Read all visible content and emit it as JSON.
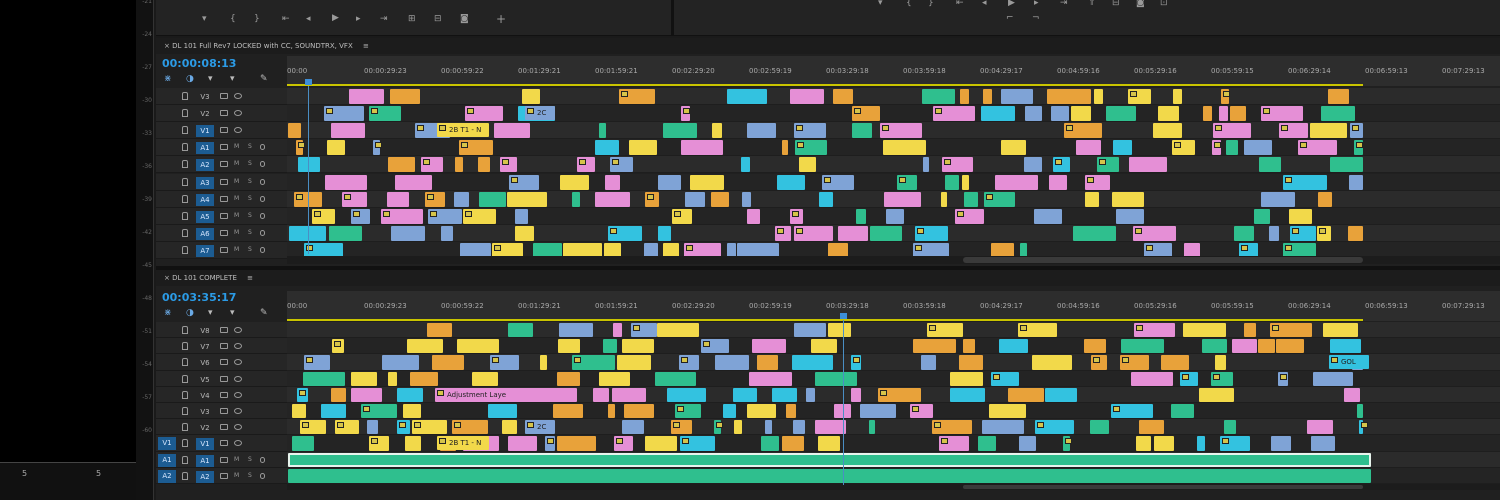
{
  "left_bottom": {
    "value_1": "5",
    "value_2": "5"
  },
  "meter_ticks": [
    "-21",
    "-24",
    "-27",
    "-30",
    "-33",
    "-36",
    "-39",
    "-42",
    "-45",
    "-48",
    "-51",
    "-54",
    "-57",
    "-60"
  ],
  "top_toolbar": {
    "left_buttons": [
      "marker-button",
      "mark-in-button",
      "mark-out-button",
      "go-to-in-button",
      "step-back-button",
      "play-button",
      "step-forward-button",
      "go-to-out-button",
      "insert-button",
      "overwrite-button",
      "export-frame-button"
    ],
    "right_add": "+",
    "left_add": "+"
  },
  "upper": {
    "tab_title": "DL 101 Full Rev7 LOCKED with CC, SOUNDTRX, VFX",
    "menu_icon": "≡",
    "timecode": "00:00:08:13",
    "ruler_labels": [
      "00:00",
      "00:00:29:23",
      "00:00:59:22",
      "00:01:29:21",
      "00:01:59:21",
      "00:02:29:20",
      "00:02:59:19",
      "00:03:29:18",
      "00:03:59:18",
      "00:04:29:17",
      "00:04:59:16",
      "00:05:29:16",
      "00:05:59:15",
      "00:06:29:14",
      "00:06:59:13",
      "00:07:29:13"
    ],
    "tracks": [
      {
        "name": "V3",
        "kind": "video"
      },
      {
        "name": "V2",
        "kind": "video"
      },
      {
        "name": "V1",
        "kind": "video",
        "selected": true
      },
      {
        "name": "A1",
        "kind": "audio",
        "selected": true
      },
      {
        "name": "A2",
        "kind": "audio",
        "selected": true
      },
      {
        "name": "A3",
        "kind": "audio",
        "selected": true
      },
      {
        "name": "A4",
        "kind": "audio",
        "selected": true
      },
      {
        "name": "A5",
        "kind": "audio",
        "selected": true
      },
      {
        "name": "A6",
        "kind": "audio",
        "selected": true
      },
      {
        "name": "A7",
        "kind": "audio",
        "selected": true
      }
    ],
    "clip_labels": {
      "v1_clip": "2B T1 - N",
      "v2_clip": "2C"
    }
  },
  "lower": {
    "tab_title": "DL 101 COMPLETE",
    "menu_icon": "≡",
    "timecode": "00:03:35:17",
    "ruler_labels": [
      "00:00",
      "00:00:29:23",
      "00:00:59:22",
      "00:01:29:21",
      "00:01:59:21",
      "00:02:29:20",
      "00:02:59:19",
      "00:03:29:18",
      "00:03:59:18",
      "00:04:29:17",
      "00:04:59:16",
      "00:05:29:16",
      "00:05:59:15",
      "00:06:29:14",
      "00:06:59:13",
      "00:07:29:13"
    ],
    "tracks": [
      {
        "name": "V8",
        "kind": "video"
      },
      {
        "name": "V7",
        "kind": "video"
      },
      {
        "name": "V6",
        "kind": "video"
      },
      {
        "name": "V5",
        "kind": "video"
      },
      {
        "name": "V4",
        "kind": "video"
      },
      {
        "name": "V3",
        "kind": "video"
      },
      {
        "name": "V2",
        "kind": "video"
      },
      {
        "name": "V1",
        "kind": "video",
        "selected": true,
        "source": "V1"
      },
      {
        "name": "A1",
        "kind": "audio",
        "selected": true,
        "source": "A1"
      },
      {
        "name": "A2",
        "kind": "audio",
        "selected": true,
        "source": "A2"
      }
    ],
    "clip_labels": {
      "adjustment": "Adjustment Laye",
      "v1_clip": "2B T1 - N",
      "v2_clip": "2C",
      "gold": "GOL"
    }
  },
  "track_controls": {
    "mute": "M",
    "solo": "S"
  },
  "colors": {
    "timecode": "#2b9be6",
    "video_blue": "#7fa3d6",
    "pink": "#e58fd6",
    "green": "#2fbf8e",
    "yellow": "#f2d94a",
    "cyan": "#33c2e0",
    "orange": "#e8a23a",
    "selected_track": "#1c5c92"
  }
}
